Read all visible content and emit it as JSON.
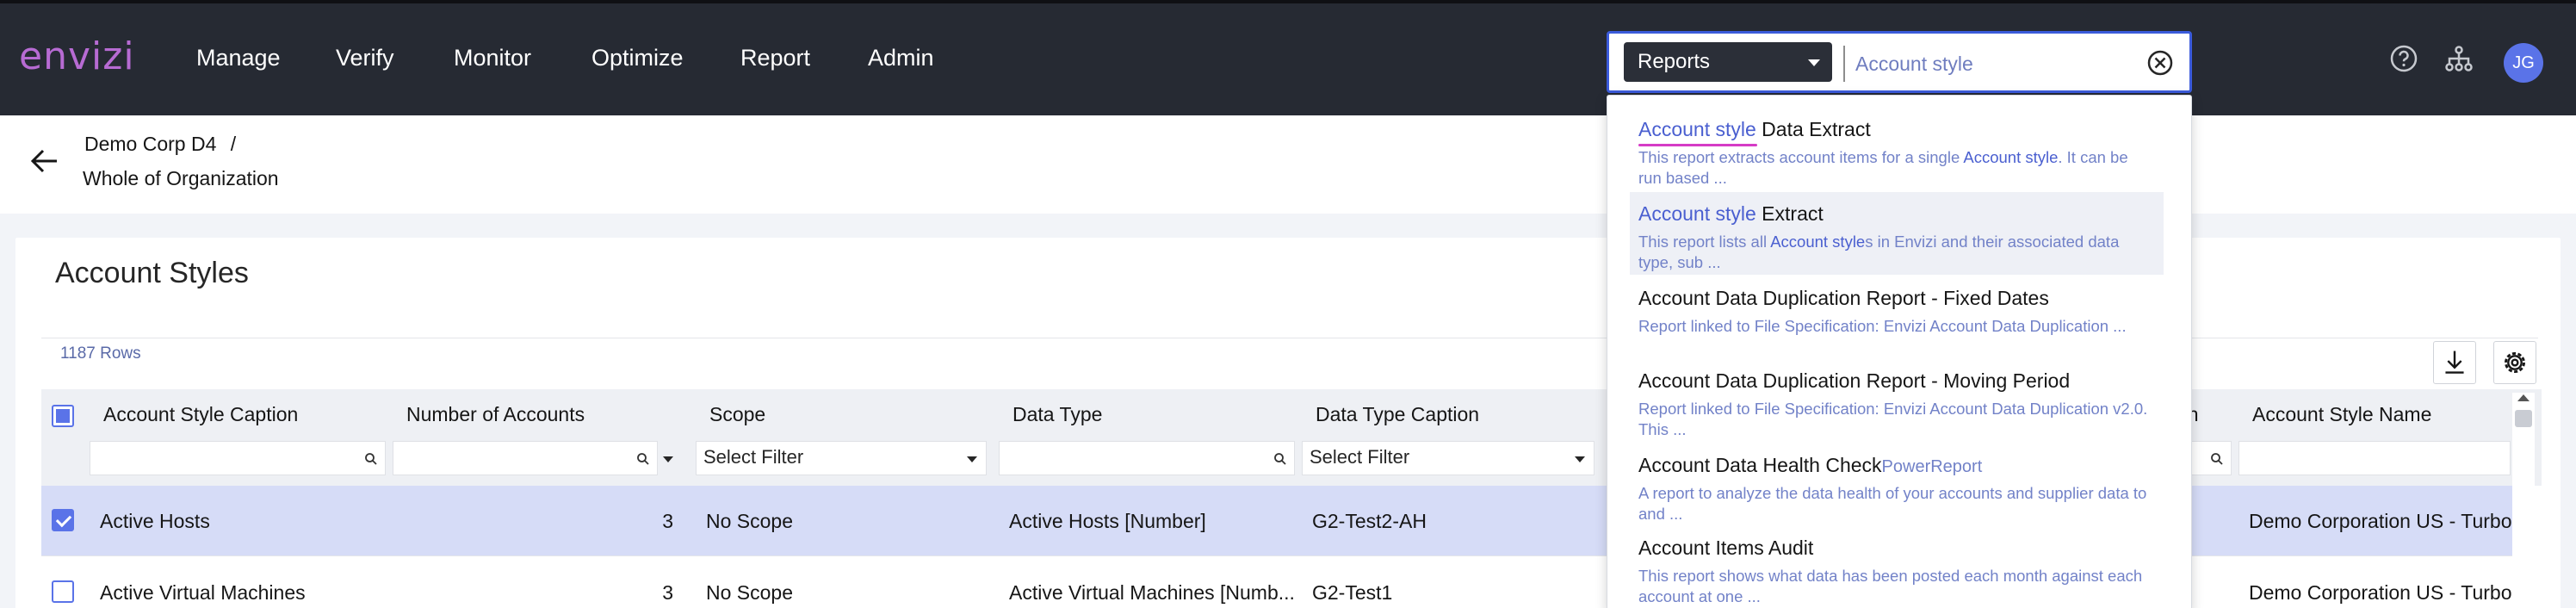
{
  "brand": {
    "logo_text": "envizi",
    "logo_color": "#b76bd3"
  },
  "nav": {
    "items": [
      "Manage",
      "Verify",
      "Monitor",
      "Optimize",
      "Report",
      "Admin"
    ]
  },
  "header_icons": [
    "help-icon",
    "org-tree-icon"
  ],
  "user": {
    "initials": "JG"
  },
  "search": {
    "scope_value": "Reports",
    "query": "Account style",
    "clear_icon": "close-circle-icon"
  },
  "breadcrumb": {
    "parent": "Demo Corp D4",
    "separator": "/",
    "current": "Whole of Organization"
  },
  "page": {
    "title": "Account Styles",
    "row_count": "1187 Rows"
  },
  "table": {
    "columns": [
      "Account Style Caption",
      "Number of Accounts",
      "Scope",
      "Data Type",
      "Data Type Caption",
      "on",
      "Account Style Name"
    ],
    "filter_select_placeholder": "Select Filter",
    "rows": [
      {
        "selected": true,
        "caption": "Active Hosts",
        "count": "3",
        "scope": "No Scope",
        "data_type": "Active Hosts [Number]",
        "dt_caption": "G2-Test2-AH",
        "name": "Demo Corporation US - Turbo"
      },
      {
        "selected": false,
        "caption": "Active Virtual Machines",
        "count": "3",
        "scope": "No Scope",
        "data_type": "Active Virtual Machines [Numb...",
        "dt_caption": "G2-Test1",
        "name": "Demo Corporation US - Turbo"
      }
    ]
  },
  "results": [
    {
      "match": "Account style",
      "rest": " Data Extract",
      "tag": "",
      "desc_pre": "This report extracts account items for a single ",
      "desc_match": "Account style",
      "desc_post": ". It can be run based ..."
    },
    {
      "match": "Account style",
      "rest": " Extract",
      "tag": "",
      "desc_pre": "This report lists all ",
      "desc_match": "Account style",
      "desc_post": "s in Envizi and their associated data type, sub ..."
    },
    {
      "match": "",
      "rest": "Account Data Duplication Report - Fixed Dates",
      "tag": "",
      "desc_pre": "Report linked to File Specification: Envizi Account Data Duplication ...",
      "desc_match": "",
      "desc_post": ""
    },
    {
      "match": "",
      "rest": "Account Data Duplication Report - Moving Period",
      "tag": "",
      "desc_pre": "Report linked to File Specification: Envizi Account Data Duplication v2.0. This ...",
      "desc_match": "",
      "desc_post": ""
    },
    {
      "match": "",
      "rest": "Account Data Health Check",
      "tag": "PowerReport",
      "desc_pre": "A report to analyze the data health of your accounts and supplier data to and ...",
      "desc_match": "",
      "desc_post": ""
    },
    {
      "match": "",
      "rest": "Account Items Audit",
      "tag": "",
      "desc_pre": "This report shows what data has been posted each month against each account at one ...",
      "desc_match": "",
      "desc_post": ""
    }
  ],
  "colors": {
    "topbar": "#262a33",
    "accent": "#5a73e8",
    "selected_row": "#d6dcf7",
    "match_text": "#4a5fd0"
  }
}
